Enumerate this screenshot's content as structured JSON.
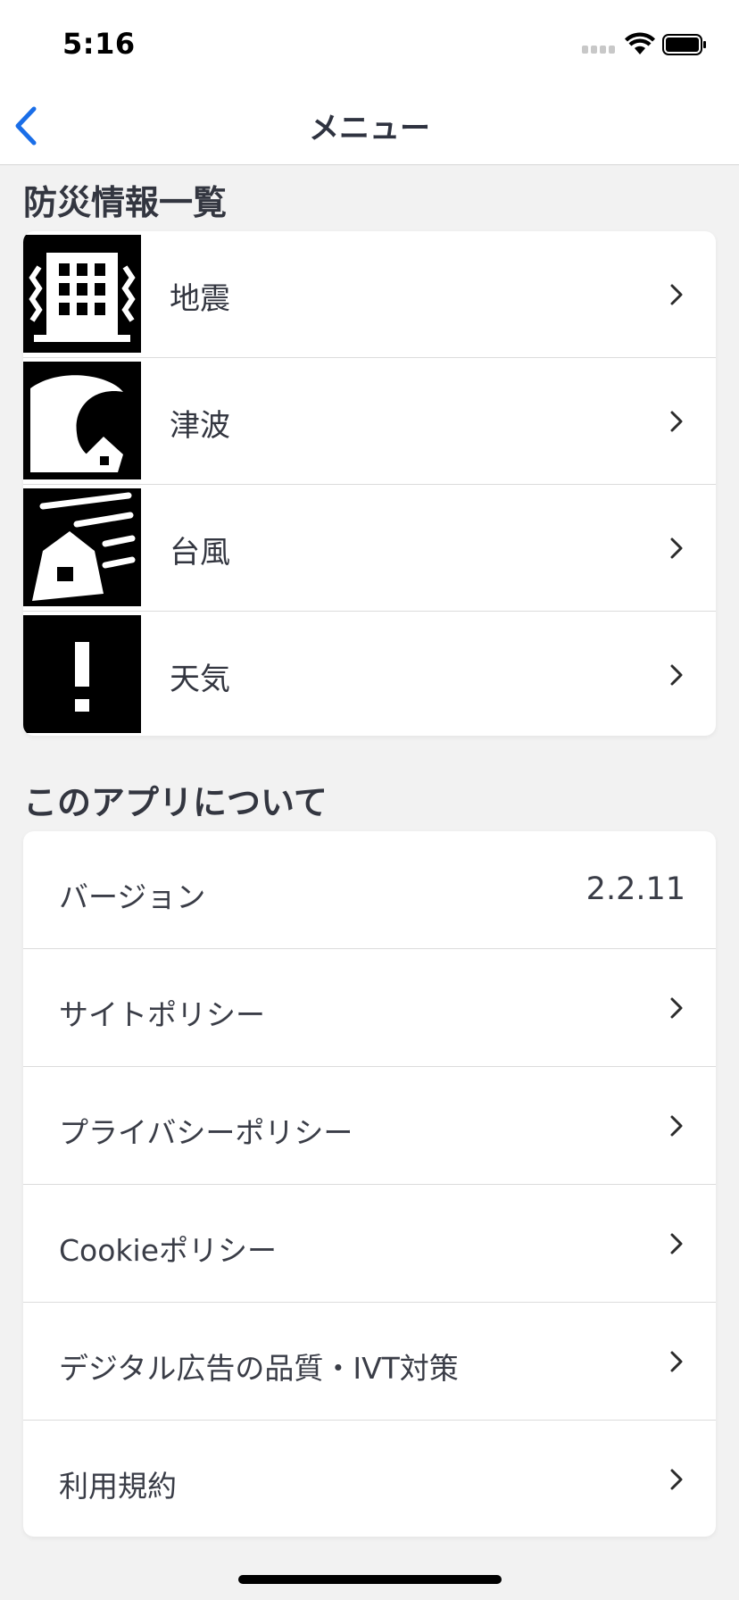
{
  "status_bar": {
    "time": "5:16"
  },
  "nav": {
    "title": "メニュー"
  },
  "disaster_section": {
    "title": "防災情報一覧",
    "items": [
      {
        "label": "地震",
        "icon": "earthquake-icon"
      },
      {
        "label": "津波",
        "icon": "tsunami-icon"
      },
      {
        "label": "台風",
        "icon": "typhoon-icon"
      },
      {
        "label": "天気",
        "icon": "weather-alert-icon"
      }
    ]
  },
  "about_section": {
    "title": "このアプリについて",
    "version_label": "バージョン",
    "version_value": "2.2.11",
    "items": [
      {
        "label": "サイトポリシー"
      },
      {
        "label": "プライバシーポリシー"
      },
      {
        "label": "Cookieポリシー"
      },
      {
        "label": "デジタル広告の品質・IVT対策"
      },
      {
        "label": "利用規約"
      }
    ]
  },
  "colors": {
    "accent": "#1a6ee8",
    "background": "#f2f2f2",
    "card": "#ffffff",
    "text": "#333640"
  }
}
